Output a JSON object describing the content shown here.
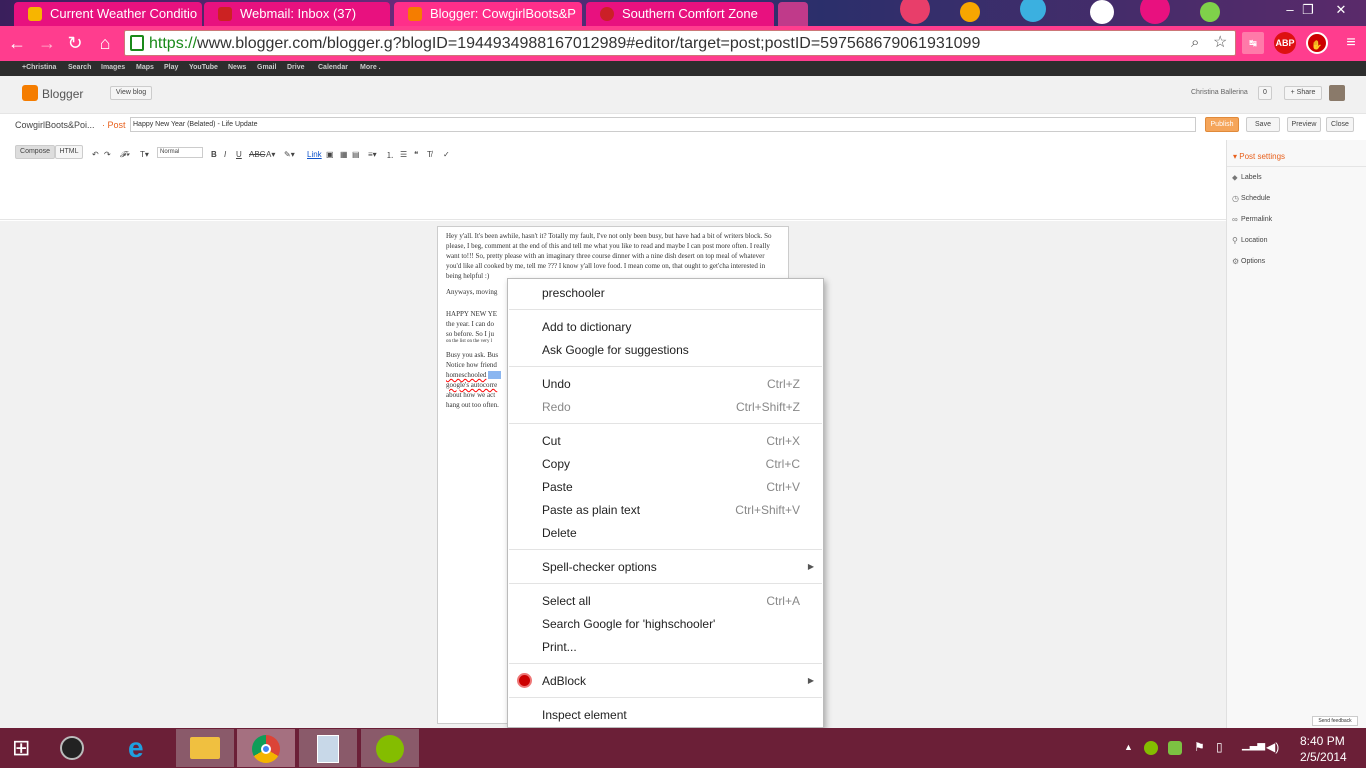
{
  "browser": {
    "tabs": [
      {
        "title": "Current Weather Conditio",
        "icon": "weather-icon"
      },
      {
        "title": "Webmail: Inbox (37)",
        "icon": "webmail-icon"
      },
      {
        "title": "Blogger: CowgirlBoots&P",
        "icon": "blogger-icon"
      },
      {
        "title": "Southern Comfort Zone",
        "icon": "pinterest-icon"
      }
    ],
    "url_proto": "https://",
    "url_rest": "www.blogger.com/blogger.g?blogID=1944934988167012989#editor/target=post;postID=5975686790619310​99",
    "extensions": [
      "ABP"
    ]
  },
  "gbar": {
    "links": [
      "+Christina",
      "Search",
      "Images",
      "Maps",
      "Play",
      "YouTube",
      "News",
      "Gmail",
      "Drive",
      "Calendar",
      "More ."
    ]
  },
  "blogger": {
    "logo_text": "Blogger",
    "view_blog": "View blog",
    "user_name": "Christina Ballerina",
    "notif_count": "0",
    "share": "+ Share",
    "blog_name": "CowgirlBoots&Poi...",
    "post_label": "· Post",
    "post_title": "Happy New Year (Belated) - Life Update",
    "publish": "Publish",
    "save": "Save",
    "preview": "Preview",
    "close": "Close",
    "compose": "Compose",
    "html": "HTML",
    "font_size": "Normal",
    "link": "Link"
  },
  "sidebar": {
    "title": "Post settings",
    "items": [
      "Labels",
      "Schedule",
      "Permalink",
      "Location",
      "Options"
    ]
  },
  "doc": {
    "p1": "Hey y'all. It's been awhile, hasn't it? Totally my fault, I've not only been busy, but have had a bit of writers block. So please, I beg, comment at the end of this and tell me what you like to read and maybe I can post more often. I really want to!!! So, pretty please with an imaginary three course dinner with a nine dish desert on top meal of whatever you'd like all cooked by me, tell me ??? I know y'all love food. I mean come on, that ought to get'cha interested in being helpful :)",
    "p2": "Anyways, moving",
    "p3a": "HAPPY NEW YE",
    "p3b": "the year. I can do",
    "p3c": "so before. So I ju",
    "p3d": "on the list on the very l",
    "p4a": "Busy you ask. Bus",
    "p4b": "Notice how friend",
    "p4c": "homeschooled",
    "p4d": "google's autocorre",
    "p4e": "about how we act",
    "p4f": "hang out too often."
  },
  "context_menu": {
    "suggestion": "preschooler",
    "add_dict": "Add to dictionary",
    "ask_google": "Ask Google for suggestions",
    "undo": "Undo",
    "undo_sc": "Ctrl+Z",
    "redo": "Redo",
    "redo_sc": "Ctrl+Shift+Z",
    "cut": "Cut",
    "cut_sc": "Ctrl+X",
    "copy": "Copy",
    "copy_sc": "Ctrl+C",
    "paste": "Paste",
    "paste_sc": "Ctrl+V",
    "paste_plain": "Paste as plain text",
    "paste_plain_sc": "Ctrl+Shift+V",
    "delete": "Delete",
    "spell_opts": "Spell-checker options",
    "select_all": "Select all",
    "select_all_sc": "Ctrl+A",
    "search_google": "Search Google for 'highschooler'",
    "print": "Print...",
    "adblock": "AdBlock",
    "inspect": "Inspect element"
  },
  "feedback": "Send feedback",
  "clock": {
    "time": "8:40 PM",
    "date": "2/5/2014"
  }
}
